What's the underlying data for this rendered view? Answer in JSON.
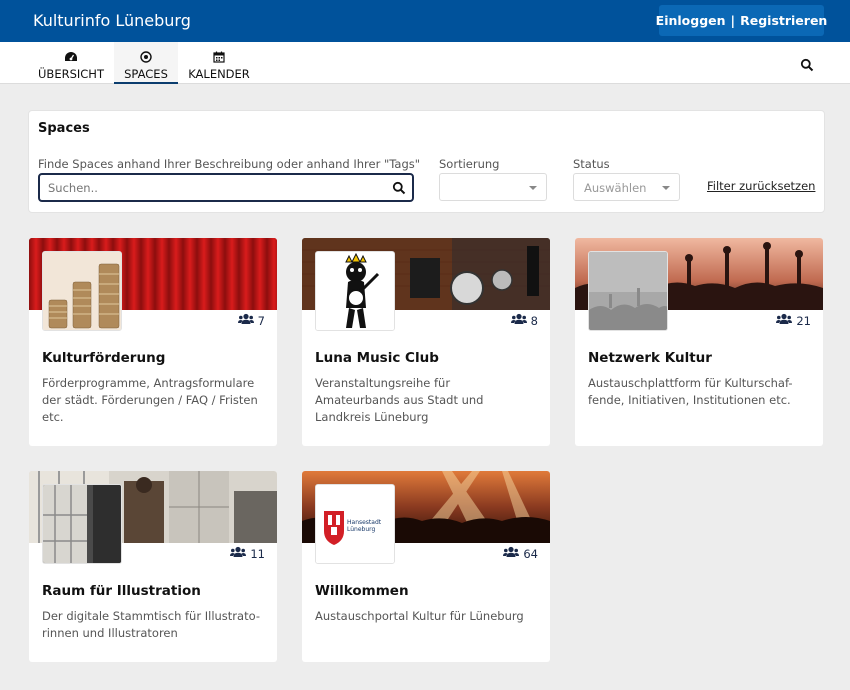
{
  "app": {
    "title": "Kulturinfo Lüneburg"
  },
  "auth": {
    "login": "Einloggen",
    "separator": "|",
    "register": "Registrieren"
  },
  "nav": {
    "items": [
      {
        "label": "ÜBERSICHT",
        "icon": "dashboard-icon"
      },
      {
        "label": "SPACES",
        "icon": "target-icon",
        "active": true
      },
      {
        "label": "KALENDER",
        "icon": "calendar-icon"
      }
    ]
  },
  "filter": {
    "title": "Spaces",
    "search_label": "Finde Spaces anhand Ihrer Beschreibung oder anhand Ihrer \"Tags\"",
    "search_placeholder": "Suchen..",
    "sort_label": "Sortierung",
    "sort_value": "",
    "status_label": "Status",
    "status_value": "Auswählen",
    "reset": "Filter zurücksetzen"
  },
  "spaces": [
    {
      "title": "Kulturförderung",
      "members": "7",
      "desc": "Förderprogramme, Antragsformulare der städt. Förderungen / FAQ / Fristen etc."
    },
    {
      "title": "Luna Music Club",
      "members": "8",
      "desc": "Veranstaltungsreihe für Amateurbands aus Stadt und Landkreis Lüneburg"
    },
    {
      "title": "Netzwerk Kultur",
      "members": "21",
      "desc": "Austauschplattform für Kulturschaf-fende, Initiativen, Institutionen etc."
    },
    {
      "title": "Raum für Illustration",
      "members": "11",
      "desc": "Der digitale Stammtisch für Illustrato-rinnen und Illustratoren"
    },
    {
      "title": "Willkommen",
      "members": "64",
      "desc": "Austauschportal Kultur für Lüneburg",
      "logo_text": "Hansestadt Lüneburg"
    }
  ],
  "colors": {
    "header": "#00529b",
    "button": "#0b68b5",
    "accent": "#1b2a4a"
  }
}
